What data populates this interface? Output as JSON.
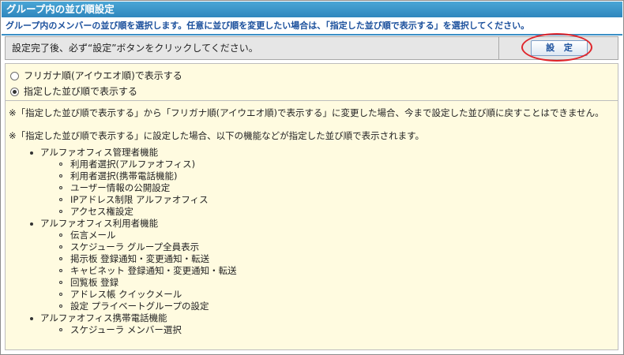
{
  "header": {
    "title": "グループ内の並び順設定",
    "subtitle": "グループ内のメンバーの並び順を選択します。任意に並び順を変更したい場合は、「指定した並び順で表示する」を選択してください。"
  },
  "settings_row": {
    "instruction": "設定完了後、必ず“設定”ボタンをクリックしてください。",
    "set_button_label": "設 定"
  },
  "options": [
    {
      "label": "フリガナ順(アイウエオ順)で表示する",
      "selected": false
    },
    {
      "label": "指定した並び順で表示する",
      "selected": true
    }
  ],
  "notes": [
    "※「指定した並び順で表示する」から「フリガナ順(アイウエオ順)で表示する」に変更した場合、今まで設定した並び順に戻すことはできません。",
    "※「指定した並び順で表示する」に設定した場合、以下の機能などが指定した並び順で表示されます。"
  ],
  "features": [
    {
      "name": "アルファオフィス管理者機能",
      "items": [
        "利用者選択(アルファオフィス)",
        "利用者選択(携帯電話機能)",
        "ユーザー情報の公開設定",
        "IPアドレス制限 アルファオフィス",
        "アクセス権設定"
      ]
    },
    {
      "name": "アルファオフィス利用者機能",
      "items": [
        "伝言メール",
        "スケジューラ グループ全員表示",
        "掲示板 登録通知・変更通知・転送",
        "キャビネット 登録通知・変更通知・転送",
        "回覧板 登録",
        "アドレス帳 クイックメール",
        "設定 プライベートグループの設定"
      ]
    },
    {
      "name": "アルファオフィス携帯電話機能",
      "items": [
        "スケジューラ メンバー選択"
      ]
    }
  ]
}
